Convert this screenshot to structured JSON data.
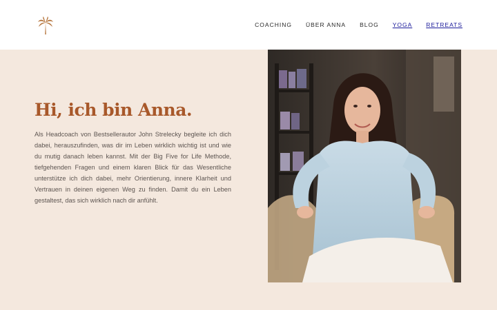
{
  "nav": {
    "items": [
      "COACHING",
      "ÜBER ANNA",
      "BLOG",
      "YOGA",
      "RETREATS"
    ]
  },
  "hero": {
    "headline": "Hi, ich bin Anna.",
    "intro": "Als Headcoach von Bestsellerautor John Strelecky begleite ich dich dabei, herauszufinden, was dir im Leben wirklich wichtig ist und wie du mutig danach leben kannst. Mit der Big Five for Life Methode, tiefgehenden Fragen und einem klaren Blick für das Wesentliche unterstütze ich dich dabei, mehr Orientierung, innere Klarheit und Vertrauen in deinen eigenen Weg zu finden. Damit du ein Leben gestaltest, das sich wirklich nach dir anfühlt."
  },
  "colors": {
    "background": "#f4e8de",
    "headline": "#a8582a",
    "nav_link": "#1a1a9a",
    "logo": "#b5743b"
  },
  "icons": {
    "logo": "palm-tree-icon"
  }
}
